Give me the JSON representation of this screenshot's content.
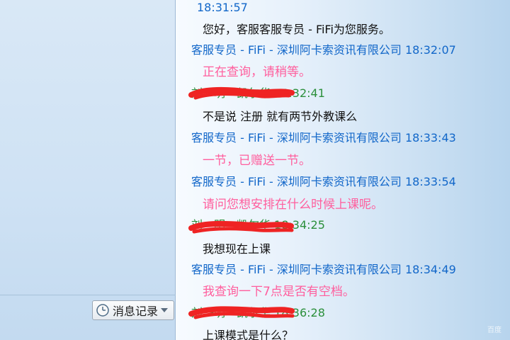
{
  "left_panel": {
    "history_button_label": "消息记录"
  },
  "chat": {
    "top_timestamp": "18:31:57",
    "messages": [
      {
        "type": "text",
        "text": "您好，客服客服专员 - FiFi为您服务。"
      },
      {
        "type": "header_blue",
        "text": "客服专员 - FiFi - 深圳阿卡索资讯有限公司 18:32:07"
      },
      {
        "type": "text_pink",
        "text": "正在查询，请稍等。"
      },
      {
        "type": "header_green",
        "text": "刘一明 - 凯尔华 18:32:41"
      },
      {
        "type": "text",
        "text": "不是说  注册  就有两节外教课么"
      },
      {
        "type": "header_blue",
        "text": "客服专员 - FiFi - 深圳阿卡索资讯有限公司 18:33:43"
      },
      {
        "type": "text_pink",
        "text": "一节，已赠送一节。"
      },
      {
        "type": "header_blue",
        "text": "客服专员 - FiFi - 深圳阿卡索资讯有限公司 18:33:54"
      },
      {
        "type": "text_pink",
        "text": "请问您想安排在什么时候上课呢。"
      },
      {
        "type": "header_green",
        "text": "刘一明 - 凯尔华 18:34:25"
      },
      {
        "type": "text",
        "text": "我想现在上课"
      },
      {
        "type": "header_blue",
        "text": "客服专员 - FiFi - 深圳阿卡索资讯有限公司 18:34:49"
      },
      {
        "type": "text_pink",
        "text": "我查询一下7点是否有空档。"
      },
      {
        "type": "header_green",
        "text": "刘一明 - 凯尔华 18:36:28"
      },
      {
        "type": "text",
        "text": "上课模式是什么？"
      }
    ]
  },
  "watermark": "百度"
}
